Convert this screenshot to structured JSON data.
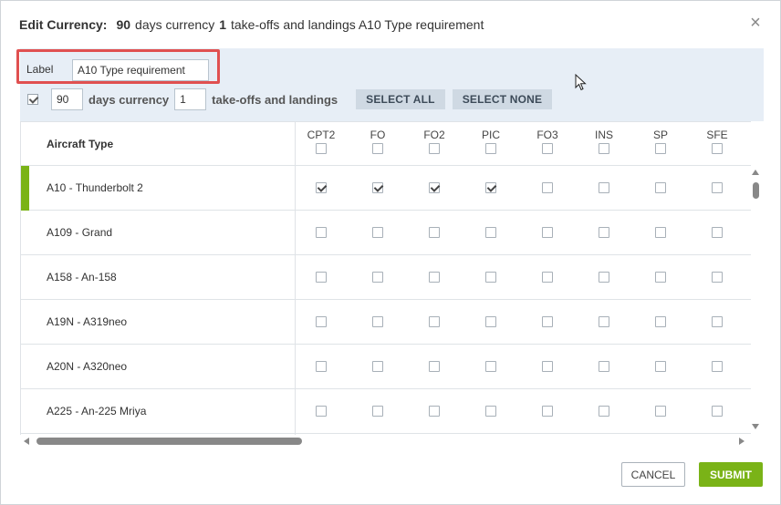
{
  "dialog": {
    "title_prefix": "Edit Currency:",
    "title_days": "90",
    "title_days_text": "days currency",
    "title_count": "1",
    "title_count_text": "take-offs and landings A10 Type requirement",
    "close_icon": "×"
  },
  "form": {
    "label_text": "Label",
    "label_value": "A10 Type requirement",
    "enabled_checked": true,
    "days_value": "90",
    "days_text": "days currency",
    "count_value": "1",
    "count_text": "take-offs and landings",
    "select_all": "SELECT ALL",
    "select_none": "SELECT NONE"
  },
  "table": {
    "type_header": "Aircraft Type",
    "columns": [
      "CPT2",
      "FO",
      "FO2",
      "PIC",
      "FO3",
      "INS",
      "SP",
      "SFE"
    ],
    "rows": [
      {
        "name": "A10 - Thunderbolt 2",
        "selected": true,
        "checks": [
          true,
          true,
          true,
          true,
          false,
          false,
          false,
          false
        ]
      },
      {
        "name": "A109 - Grand",
        "selected": false,
        "checks": [
          false,
          false,
          false,
          false,
          false,
          false,
          false,
          false
        ]
      },
      {
        "name": "A158 - An-158",
        "selected": false,
        "checks": [
          false,
          false,
          false,
          false,
          false,
          false,
          false,
          false
        ]
      },
      {
        "name": "A19N - A319neo",
        "selected": false,
        "checks": [
          false,
          false,
          false,
          false,
          false,
          false,
          false,
          false
        ]
      },
      {
        "name": "A20N - A320neo",
        "selected": false,
        "checks": [
          false,
          false,
          false,
          false,
          false,
          false,
          false,
          false
        ]
      },
      {
        "name": "A225 - An-225 Mriya",
        "selected": false,
        "checks": [
          false,
          false,
          false,
          false,
          false,
          false,
          false,
          false
        ]
      }
    ]
  },
  "footer": {
    "cancel": "CANCEL",
    "submit": "SUBMIT"
  },
  "colors": {
    "accent_green": "#7ab317",
    "panel_bg": "#e7eef6",
    "highlight_red": "#e05050"
  }
}
